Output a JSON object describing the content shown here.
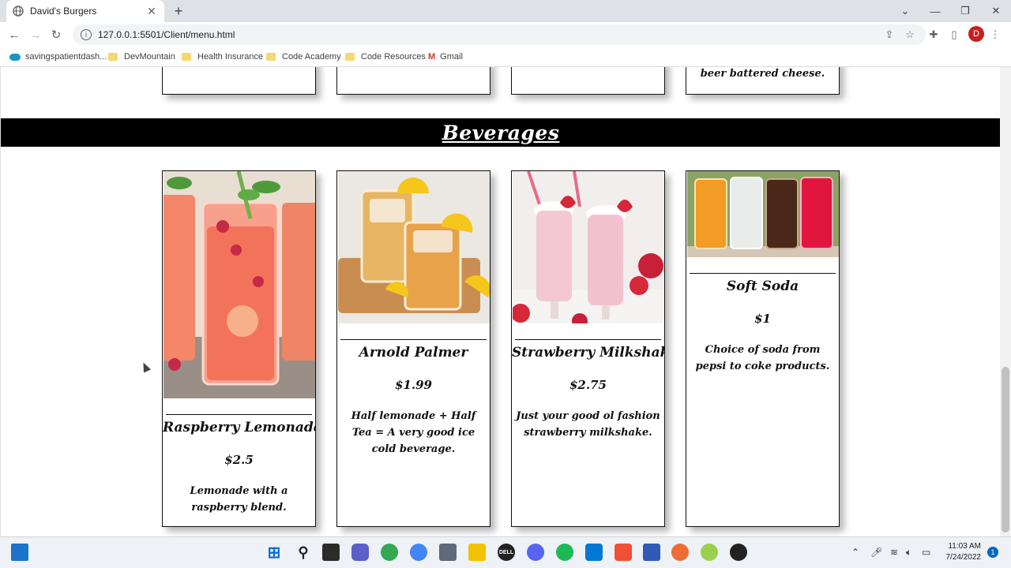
{
  "browser": {
    "tab_title": "David's Burgers",
    "url": "127.0.0.1:5501/Client/menu.html",
    "profile_initial": "D",
    "bookmarks": [
      "savingspatientdash...",
      "DevMountain",
      "Health Insurance",
      "Code Academy",
      "Code Resources",
      "Gmail"
    ]
  },
  "previous_section": {
    "last_card_description": "beer battered cheese."
  },
  "beverages": {
    "heading": "Beverages",
    "items": [
      {
        "name": "Raspberry Lemonade",
        "price": "$2.5",
        "description": "Lemonade with a raspberry blend."
      },
      {
        "name": "Arnold Palmer",
        "price": "$1.99",
        "description": "Half lemonade + Half Tea = A very good ice cold beverage."
      },
      {
        "name": "Strawberry Milkshake",
        "price": "$2.75",
        "description": "Just your good ol fashion strawberry milkshake."
      },
      {
        "name": "Soft Soda",
        "price": "$1",
        "description": "Choice of soda from pepsi to coke products."
      }
    ]
  },
  "taskbar": {
    "time": "11:03 AM",
    "date": "7/24/2022",
    "notification_count": "1"
  }
}
